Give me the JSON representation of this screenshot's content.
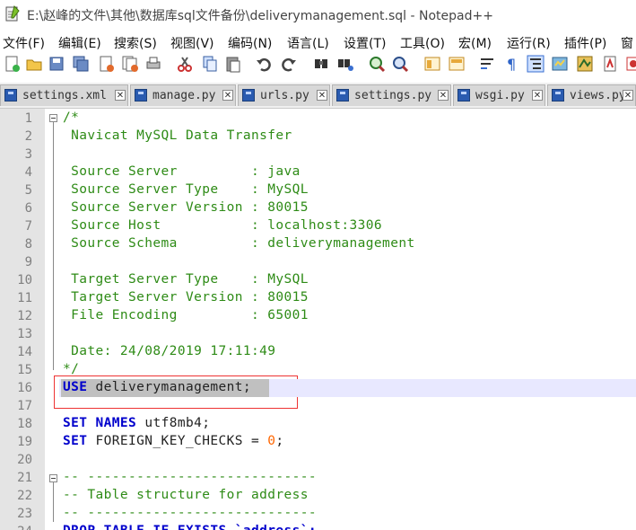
{
  "window": {
    "title": "E:\\赵峰的文件\\其他\\数据库sql文件备份\\deliverymanagement.sql - Notepad++"
  },
  "menu": [
    "文件(F)",
    "编辑(E)",
    "搜索(S)",
    "视图(V)",
    "编码(N)",
    "语言(L)",
    "设置(T)",
    "工具(O)",
    "宏(M)",
    "运行(R)",
    "插件(P)",
    "窗"
  ],
  "toolbar": [
    "new-file-icon",
    "open-file-icon",
    "save-icon",
    "save-all-icon",
    "close-icon",
    "close-all-icon",
    "print-icon",
    "cut-icon",
    "copy-icon",
    "paste-icon",
    "undo-icon",
    "redo-icon",
    "find-icon",
    "replace-icon",
    "zoom-in-icon",
    "zoom-out-icon",
    "sync-vertical-icon",
    "sync-horizontal-icon",
    "word-wrap-icon",
    "show-all-chars-icon",
    "indent-guide-icon",
    "doc-map-icon",
    "function-list-icon",
    "folder-workspace-icon",
    "record-macro-icon"
  ],
  "tabs": [
    {
      "label": "settings.xml",
      "close": "✕"
    },
    {
      "label": "manage.py",
      "close": "✕"
    },
    {
      "label": "urls.py",
      "close": "✕"
    },
    {
      "label": "settings.py",
      "close": "✕"
    },
    {
      "label": "wsgi.py",
      "close": "✕"
    },
    {
      "label": "views.py",
      "close": "✕"
    }
  ],
  "editor": {
    "lines": [
      {
        "n": "1",
        "parts": [
          {
            "t": "/*",
            "c": "cm"
          }
        ]
      },
      {
        "n": "2",
        "parts": [
          {
            "t": " Navicat MySQL Data Transfer",
            "c": "cm"
          }
        ]
      },
      {
        "n": "3",
        "parts": []
      },
      {
        "n": "4",
        "parts": [
          {
            "t": " Source Server         : java",
            "c": "cm"
          }
        ]
      },
      {
        "n": "5",
        "parts": [
          {
            "t": " Source Server Type    : MySQL",
            "c": "cm"
          }
        ]
      },
      {
        "n": "6",
        "parts": [
          {
            "t": " Source Server Version : 80015",
            "c": "cm"
          }
        ]
      },
      {
        "n": "7",
        "parts": [
          {
            "t": " Source Host           : localhost:3306",
            "c": "cm"
          }
        ]
      },
      {
        "n": "8",
        "parts": [
          {
            "t": " Source Schema         : deliverymanagement",
            "c": "cm"
          }
        ]
      },
      {
        "n": "9",
        "parts": []
      },
      {
        "n": "10",
        "parts": [
          {
            "t": " Target Server Type    : MySQL",
            "c": "cm"
          }
        ]
      },
      {
        "n": "11",
        "parts": [
          {
            "t": " Target Server Version : 80015",
            "c": "cm"
          }
        ]
      },
      {
        "n": "12",
        "parts": [
          {
            "t": " File Encoding         : 65001",
            "c": "cm"
          }
        ]
      },
      {
        "n": "13",
        "parts": []
      },
      {
        "n": "14",
        "parts": [
          {
            "t": " Date: 24/08/2019 17:11:49",
            "c": "cm"
          }
        ]
      },
      {
        "n": "15",
        "parts": [
          {
            "t": "*/",
            "c": "cm"
          }
        ]
      },
      {
        "n": "16",
        "parts": [
          {
            "t": "USE",
            "c": "kw"
          },
          {
            "t": " deliverymanagement;",
            "c": "tx"
          }
        ]
      },
      {
        "n": "17",
        "parts": []
      },
      {
        "n": "18",
        "parts": [
          {
            "t": "SET",
            "c": "kw"
          },
          {
            "t": " ",
            "c": "tx"
          },
          {
            "t": "NAMES",
            "c": "kw"
          },
          {
            "t": " utf8mb4;",
            "c": "tx"
          }
        ]
      },
      {
        "n": "19",
        "parts": [
          {
            "t": "SET",
            "c": "kw"
          },
          {
            "t": " FOREIGN_KEY_CHECKS = ",
            "c": "tx"
          },
          {
            "t": "0",
            "c": "num"
          },
          {
            "t": ";",
            "c": "tx"
          }
        ]
      },
      {
        "n": "20",
        "parts": []
      },
      {
        "n": "21",
        "parts": [
          {
            "t": "-- ----------------------------",
            "c": "cm"
          }
        ]
      },
      {
        "n": "22",
        "parts": [
          {
            "t": "-- Table structure for address",
            "c": "cm"
          }
        ]
      },
      {
        "n": "23",
        "parts": [
          {
            "t": "-- ----------------------------",
            "c": "cm"
          }
        ]
      },
      {
        "n": "24",
        "parts": [
          {
            "t": "DROP TABLE IF EXISTS `address`;",
            "c": "kw"
          }
        ]
      }
    ],
    "highlighted_line": "16"
  }
}
